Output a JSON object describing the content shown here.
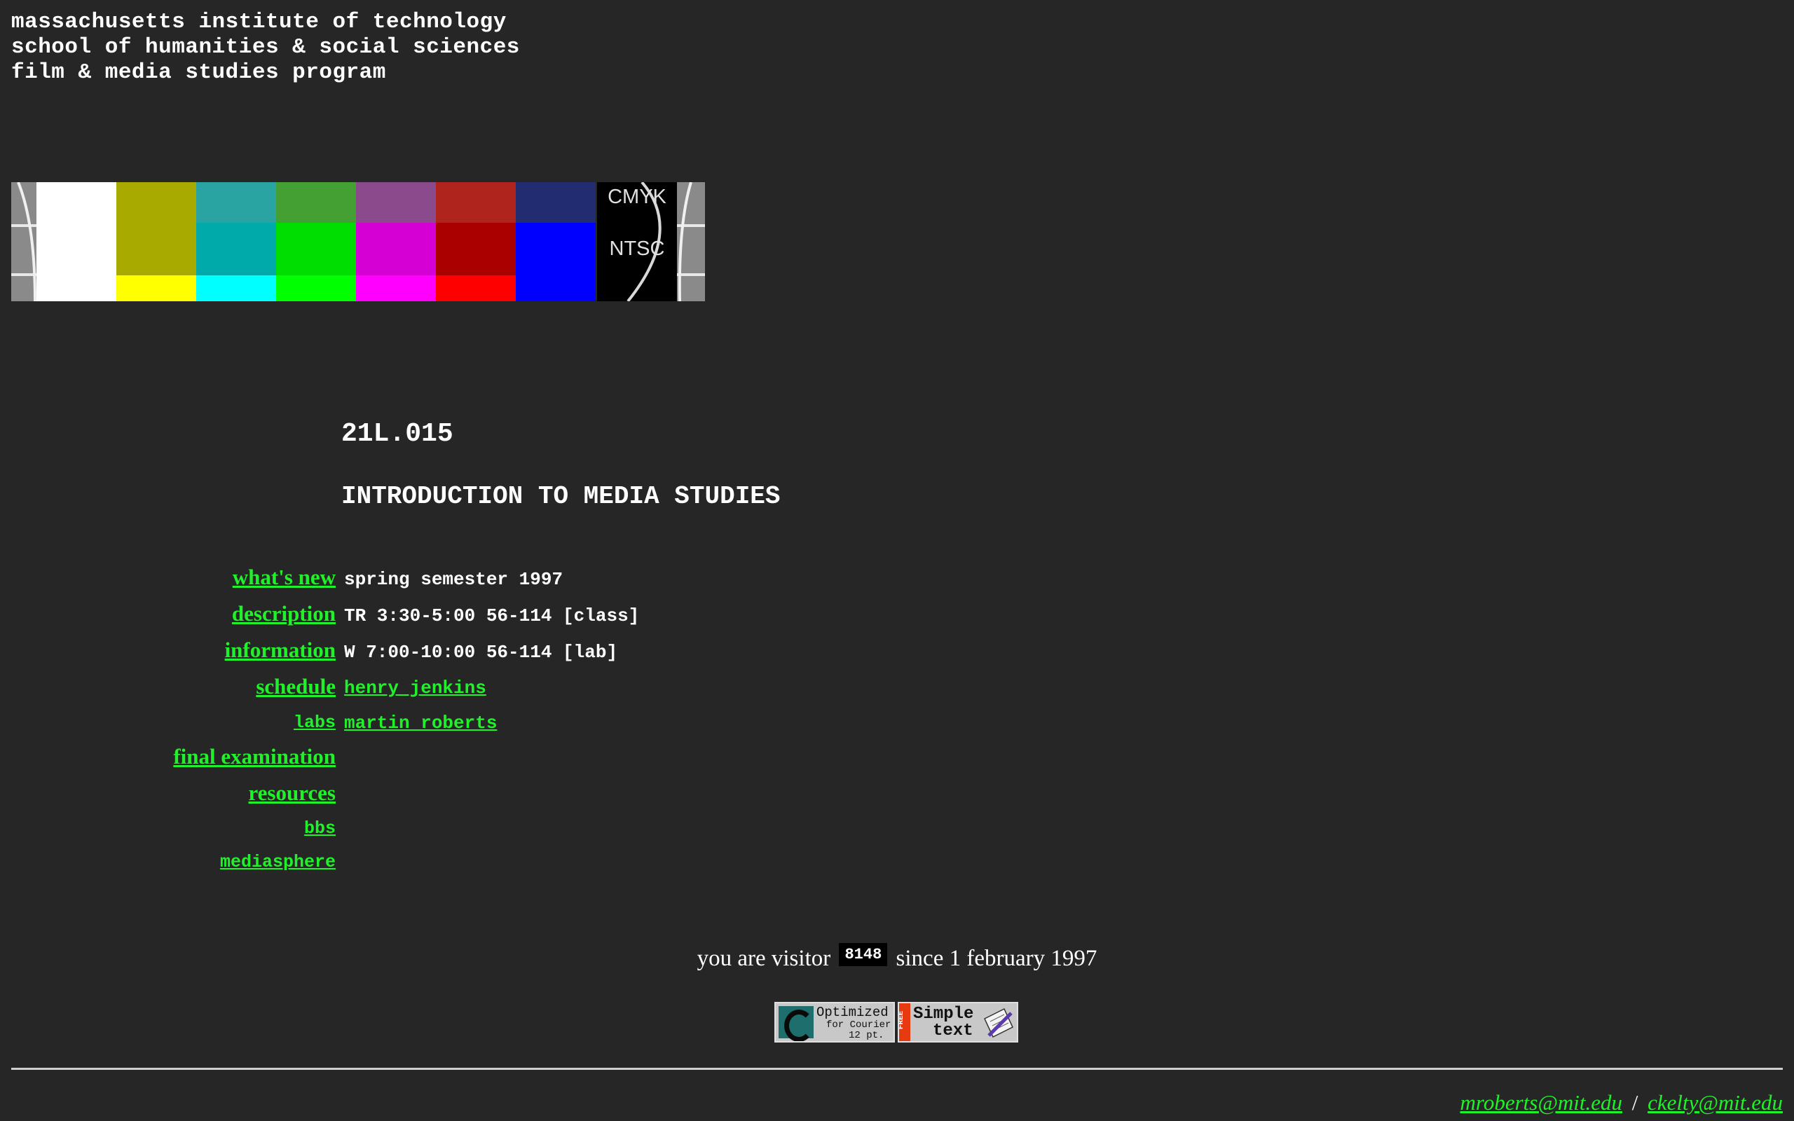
{
  "header": {
    "line1": "massachusetts institute of technology",
    "line2": "school of humanities & social sciences",
    "line3": "film & media studies program"
  },
  "test_pattern": {
    "label_top": "CMYK",
    "label_bottom": "NTSC",
    "colors": {
      "top": [
        "#a8aa00",
        "#2aa3a3",
        "#44a032",
        "#8a4a8c",
        "#b0241e",
        "#222c70"
      ],
      "middle": [
        "#a8aa00",
        "#00aaaa",
        "#00dd00",
        "#d400d4",
        "#aa0000",
        "#0000ff"
      ],
      "bottom": [
        "#ffff00",
        "#00ffff",
        "#00ff00",
        "#ff00ff",
        "#ff0000",
        "#0000ff"
      ]
    }
  },
  "course": {
    "number": "21L.015",
    "title": "INTRODUCTION TO MEDIA STUDIES"
  },
  "nav": [
    {
      "label": "what's new"
    },
    {
      "label": "description"
    },
    {
      "label": "information"
    },
    {
      "label": "schedule"
    },
    {
      "label": "labs"
    },
    {
      "label": "final examination"
    },
    {
      "label": "resources"
    },
    {
      "label": "bbs"
    },
    {
      "label": "mediasphere"
    }
  ],
  "info": {
    "semester": "spring semester 1997",
    "class_time": "TR 3:30-5:00 56-114 [class]",
    "lab_time": "W 7:00-10:00 56-114 [lab]",
    "instructor1": "henry jenkins",
    "instructor2": "martin roberts"
  },
  "visitor": {
    "prefix": "you are visitor",
    "count": "8148",
    "suffix": "since 1 february 1997"
  },
  "badges": {
    "courier_line1": "Optimized",
    "courier_line2": "for Courier",
    "courier_line3": "12 pt.",
    "simpletext_side": "FREE",
    "simpletext_line1": "Simple",
    "simpletext_line2": "text"
  },
  "footer": {
    "email1": "mroberts@mit.edu",
    "separator": "/",
    "email2": "ckelty@mit.edu"
  }
}
